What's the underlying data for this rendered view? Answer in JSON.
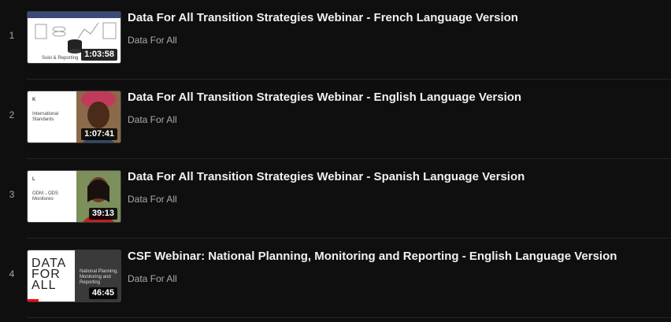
{
  "playlist": {
    "items": [
      {
        "index": "1",
        "title": "Data For All Transition Strategies Webinar - French Language Version",
        "channel": "Data For All",
        "duration": "1:03:58",
        "thumb_caption": "Suivi & Reporting"
      },
      {
        "index": "2",
        "title": "Data For All Transition Strategies Webinar - English Language Version",
        "channel": "Data For All",
        "duration": "1:07:41",
        "thumb_caption": "International Standards",
        "thumb_letter": "K"
      },
      {
        "index": "3",
        "title": "Data For All Transition Strategies Webinar - Spanish Language Version",
        "channel": "Data For All",
        "duration": "39:13",
        "thumb_caption": "ODM→ODS Monitoreo",
        "thumb_letter": "L"
      },
      {
        "index": "4",
        "title": "CSF Webinar: National Planning, Monitoring and Reporting - English Language Version",
        "channel": "Data For All",
        "duration": "46:45",
        "thumb_logo": "DATA FOR ALL",
        "thumb_caption": "National Planning, Monitoring and Reporting"
      }
    ]
  },
  "colors": {
    "background": "#0f0f0f",
    "title": "#f1f1f1",
    "meta": "#aaaaaa",
    "progress": "#ff0000"
  }
}
